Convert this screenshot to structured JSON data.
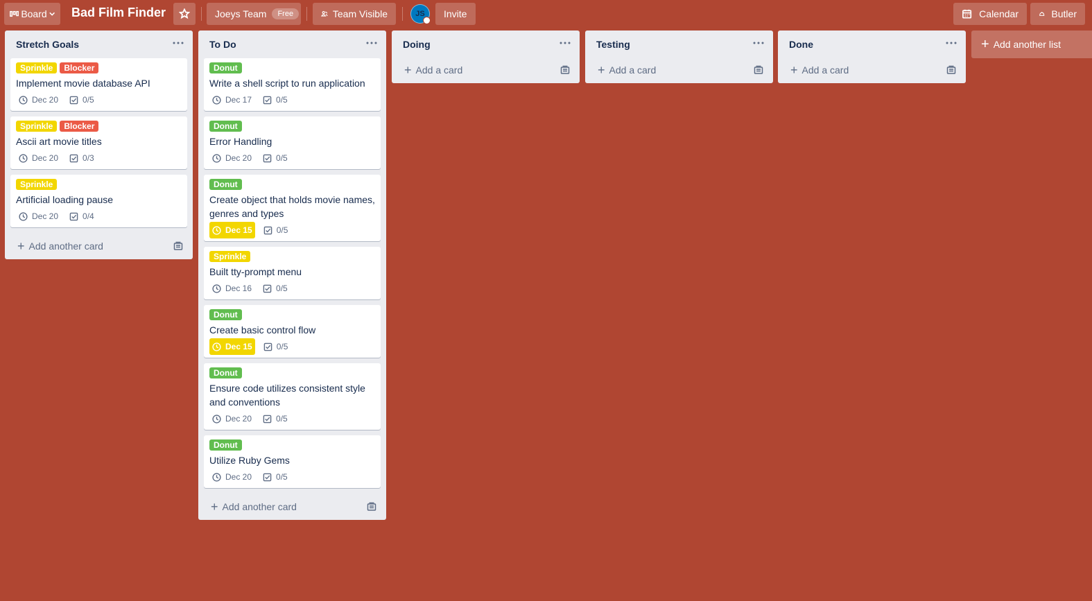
{
  "header": {
    "board_switcher_label": "Board",
    "board_title": "Bad Film Finder",
    "team_label": "Joeys Team",
    "team_badge": "Free",
    "visibility_label": "Team Visible",
    "avatar_initials": "JS",
    "invite_label": "Invite",
    "calendar_label": "Calendar",
    "butler_label": "Butler"
  },
  "colors": {
    "board_background": "#b04632",
    "list_background": "#ebecf0",
    "label_yellow": "#f2d600",
    "label_red": "#eb5a46",
    "label_green": "#61bd4f"
  },
  "lists": [
    {
      "title": "Stretch Goals",
      "add_card_label": "Add another card",
      "cards": [
        {
          "labels": [
            {
              "text": "Sprinkle",
              "color": "yellow"
            },
            {
              "text": "Blocker",
              "color": "red"
            }
          ],
          "title": "Implement movie database API",
          "due": "Dec 20",
          "due_soon": false,
          "checklist": "0/5"
        },
        {
          "labels": [
            {
              "text": "Sprinkle",
              "color": "yellow"
            },
            {
              "text": "Blocker",
              "color": "red"
            }
          ],
          "title": "Ascii art movie titles",
          "due": "Dec 20",
          "due_soon": false,
          "checklist": "0/3"
        },
        {
          "labels": [
            {
              "text": "Sprinkle",
              "color": "yellow"
            }
          ],
          "title": "Artificial loading pause",
          "due": "Dec 20",
          "due_soon": false,
          "checklist": "0/4"
        }
      ]
    },
    {
      "title": "To Do",
      "add_card_label": "Add another card",
      "cards": [
        {
          "labels": [
            {
              "text": "Donut",
              "color": "green"
            }
          ],
          "title": "Write a shell script to run application",
          "due": "Dec 17",
          "due_soon": false,
          "checklist": "0/5"
        },
        {
          "labels": [
            {
              "text": "Donut",
              "color": "green"
            }
          ],
          "title": "Error Handling",
          "due": "Dec 20",
          "due_soon": false,
          "checklist": "0/5"
        },
        {
          "labels": [
            {
              "text": "Donut",
              "color": "green"
            }
          ],
          "title": "Create object that holds movie names, genres and types",
          "due": "Dec 15",
          "due_soon": true,
          "checklist": "0/5"
        },
        {
          "labels": [
            {
              "text": "Sprinkle",
              "color": "yellow"
            }
          ],
          "title": "Built tty-prompt menu",
          "due": "Dec 16",
          "due_soon": false,
          "checklist": "0/5"
        },
        {
          "labels": [
            {
              "text": "Donut",
              "color": "green"
            }
          ],
          "title": "Create basic control flow",
          "due": "Dec 15",
          "due_soon": true,
          "checklist": "0/5"
        },
        {
          "labels": [
            {
              "text": "Donut",
              "color": "green"
            }
          ],
          "title": "Ensure code utilizes consistent style and conventions",
          "due": "Dec 20",
          "due_soon": false,
          "checklist": "0/5"
        },
        {
          "labels": [
            {
              "text": "Donut",
              "color": "green"
            }
          ],
          "title": "Utilize Ruby Gems",
          "due": "Dec 20",
          "due_soon": false,
          "checklist": "0/5"
        }
      ]
    },
    {
      "title": "Doing",
      "add_card_label": "Add a card",
      "cards": []
    },
    {
      "title": "Testing",
      "add_card_label": "Add a card",
      "cards": []
    },
    {
      "title": "Done",
      "add_card_label": "Add a card",
      "cards": []
    }
  ],
  "add_list_label": "Add another list"
}
